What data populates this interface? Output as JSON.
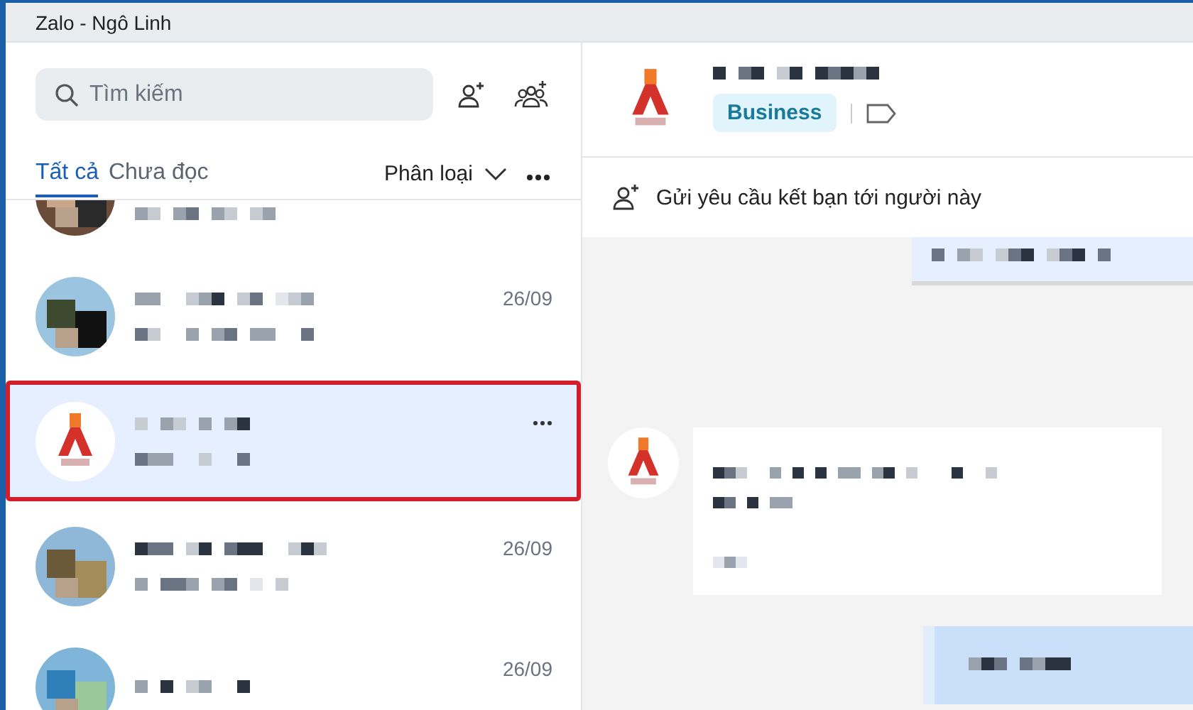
{
  "window": {
    "title": "Zalo - Ngô Linh"
  },
  "sidebar": {
    "search": {
      "placeholder": "Tìm kiếm"
    },
    "tabs": [
      {
        "label": "Tất cả",
        "selected": true
      },
      {
        "label": "Chưa đọc",
        "selected": false
      }
    ],
    "filter": {
      "label": "Phân loại"
    },
    "conversations": [
      {
        "kind": "photo",
        "selected": false,
        "hovered": false,
        "outlined": false
      },
      {
        "kind": "photo",
        "time": "26/09",
        "selected": false,
        "hovered": false,
        "outlined": false
      },
      {
        "kind": "logo",
        "selected": true,
        "hovered": true,
        "outlined": true
      },
      {
        "kind": "photo",
        "time": "26/09",
        "selected": false,
        "hovered": false,
        "outlined": false
      },
      {
        "kind": "photo",
        "time": "26/09",
        "selected": false,
        "hovered": false,
        "outlined": false
      }
    ]
  },
  "chat": {
    "header": {
      "badge": "Business"
    },
    "friend_request": {
      "label": "Gửi yêu cầu kết bạn tới người này"
    },
    "messages": [
      {
        "kind": "outgoing"
      },
      {
        "kind": "incoming"
      },
      {
        "kind": "outgoing"
      }
    ]
  }
}
